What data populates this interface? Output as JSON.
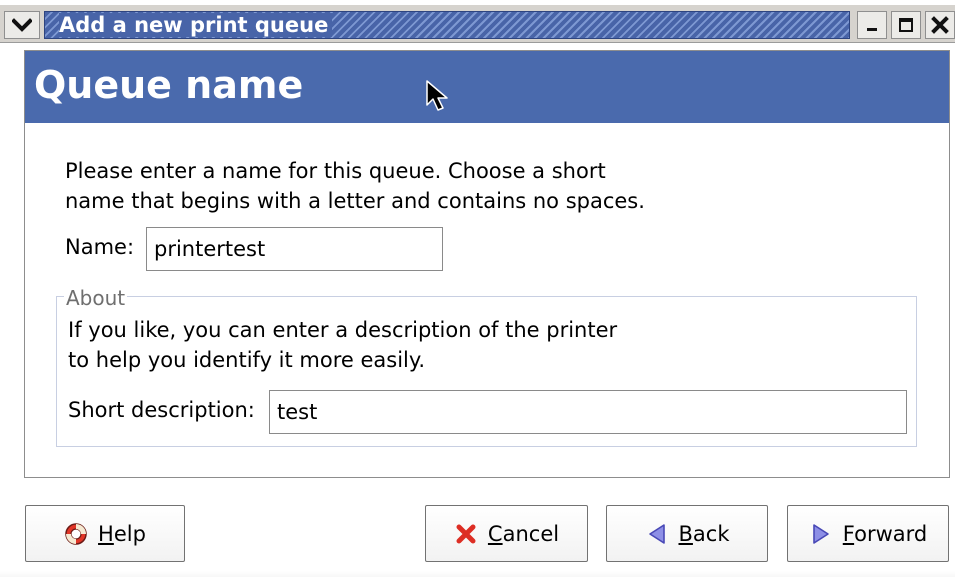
{
  "window": {
    "title": "Add a new print queue",
    "controls": [
      "menu-icon",
      "minimize-icon",
      "maximize-icon",
      "close-icon"
    ]
  },
  "page": {
    "header_title": "Queue name",
    "intro_text": "Please enter a name for this queue.  Choose a short\nname that begins with a letter and contains no spaces.",
    "name_label": "Name:",
    "name_value": "printertest",
    "about_legend": "About",
    "about_text": "If you like, you can enter a description of the printer\nto help you identify it more easily.",
    "short_description_label": "Short description:",
    "short_description_value": "test"
  },
  "buttons": {
    "help": "Help",
    "cancel": "Cancel",
    "back": "Back",
    "forward": "Forward"
  },
  "colors": {
    "titlebar_blue": "#4864a8",
    "header_blue": "#4a6aad",
    "cancel_red": "#dd2e24",
    "navigation_blue": "#5f6fd5"
  },
  "icons": {
    "help": "lifebuoy-icon",
    "cancel": "x-icon",
    "back": "left-triangle-icon",
    "forward": "right-triangle-icon"
  }
}
